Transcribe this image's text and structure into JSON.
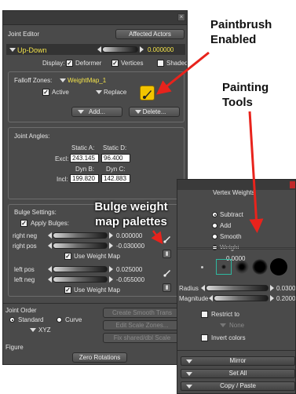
{
  "joint_editor": {
    "title": "Joint Editor",
    "affected_actors_btn": "Affected Actors",
    "parameter_name": "Up-Down",
    "parameter_value": "0.000000",
    "display_label": "Display:",
    "display_deformer": "Deformer",
    "display_vertices": "Vertices",
    "display_shaded": "Shaded",
    "falloff_label": "Falloff Zones:",
    "falloff_value": "WeightMap_1",
    "active_label": "Active",
    "replace_label": "Replace",
    "add_btn": "Add...",
    "delete_btn": "Delete...",
    "joint_angles_label": "Joint Angles:",
    "static_a": "Static A:",
    "static_d": "Static D:",
    "excl_label": "Excl:",
    "excl_a": "243.145",
    "excl_d": "96.400",
    "dyn_b": "Dyn B:",
    "dyn_c": "Dyn C:",
    "incl_label": "Incl:",
    "incl_b": "199.820",
    "incl_c": "142.883",
    "bulge_settings_label": "Bulge Settings:",
    "apply_bulges": "Apply Bulges:",
    "right_neg_label": "right neg",
    "right_neg_value": "0.000000",
    "right_pos_label": "right pos",
    "right_pos_value": "-0.030000",
    "use_weight_map_1": "Use Weight Map",
    "left_pos_label": "left pos",
    "left_pos_value": "0.025000",
    "left_neg_label": "left neg",
    "left_neg_value": "-0.055000",
    "use_weight_map_2": "Use Weight Map",
    "joint_order_label": "Joint Order",
    "standard_label": "Standard",
    "curve_label": "Curve",
    "xyz_value": "XYZ",
    "create_smooth_btn": "Create Smooth Trans",
    "edit_scale_btn": "Edit Scale Zones...",
    "fix_scale_btn": "Fix shared/dbl Scale",
    "figure_label": "Figure",
    "zero_rotations_btn": "Zero Rotations"
  },
  "vertex_weights": {
    "title": "Vertex Weights",
    "modes": [
      "Subtract",
      "Add",
      "Smooth",
      "Weight"
    ],
    "selected_mode": "Subtract",
    "weight_value": "0.0000",
    "radius_label": "Radius",
    "radius_value": "0.0300",
    "magnitude_label": "Magnitude",
    "magnitude_value": "0.2000",
    "restrict_label": "Restrict to",
    "restrict_value": "None",
    "invert_label": "Invert colors",
    "mirror_btn": "Mirror",
    "set_all_btn": "Set All",
    "copy_paste_btn": "Copy / Paste"
  },
  "annotations": {
    "paintbrush": "Paintbrush\nEnabled",
    "painting_tools": "Painting\nTools",
    "bulge_palettes": "Bulge weight\nmap palettes"
  },
  "colors": {
    "panel_bg": "#4a4a4a",
    "highlight_yellow": "#f3c400",
    "arrow_red": "#e8231c",
    "value_yellow": "#f2e24a"
  }
}
